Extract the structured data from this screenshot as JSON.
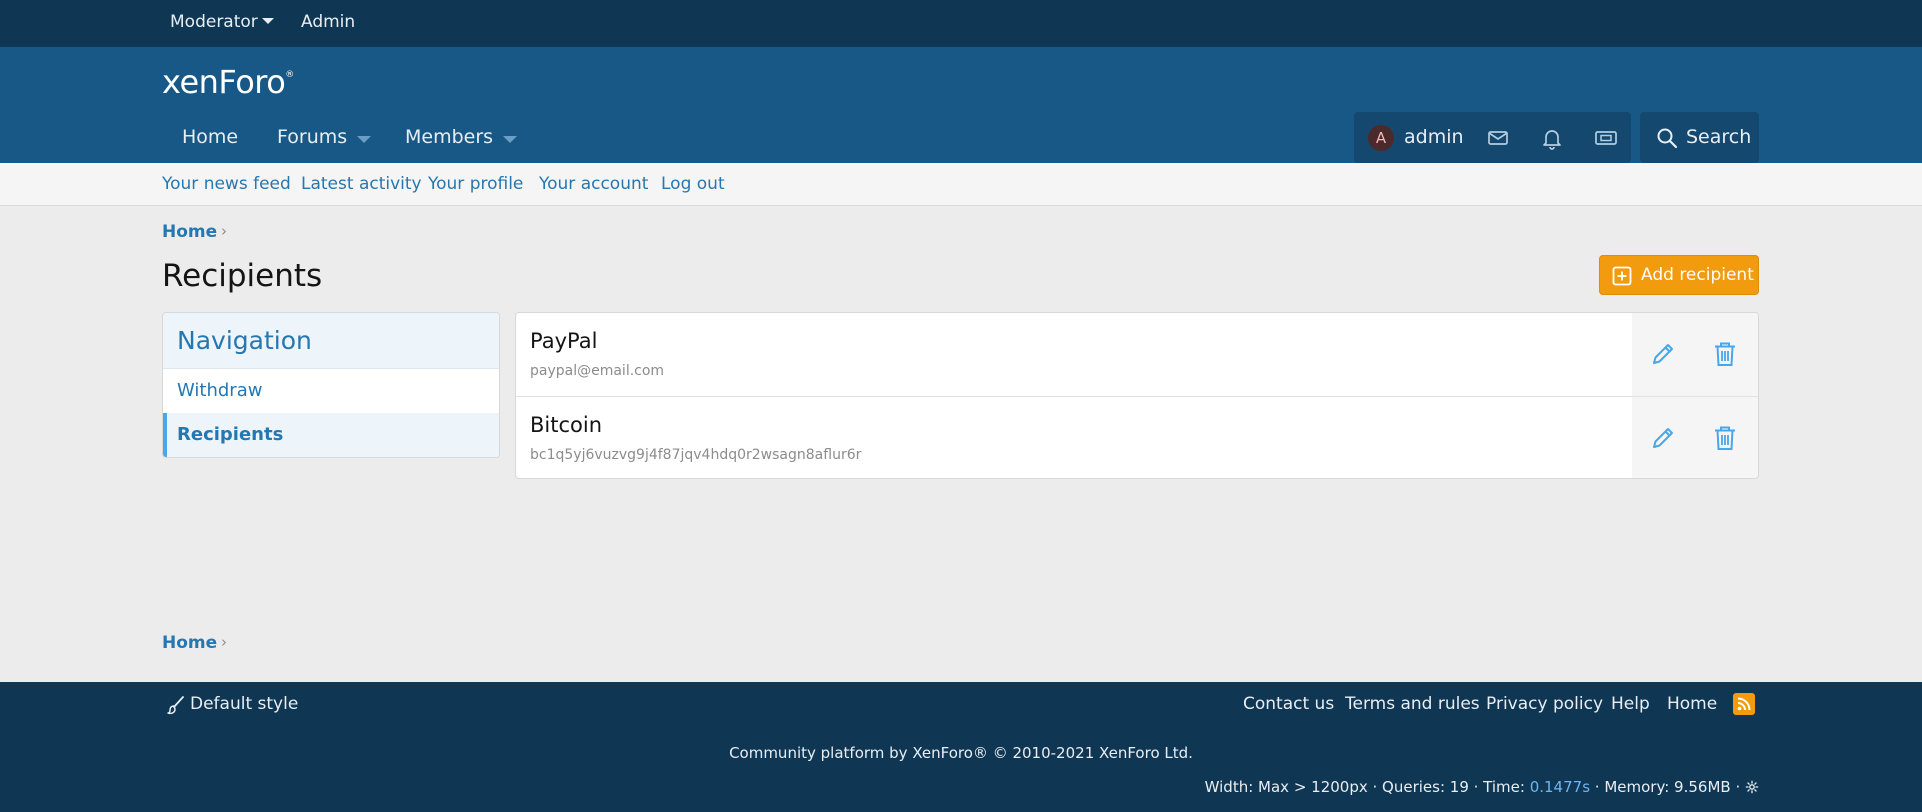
{
  "staffbar": {
    "moderator": "Moderator",
    "admin": "Admin"
  },
  "header": {
    "logo": "xenForo",
    "logo_mark": "®",
    "nav": {
      "home": "Home",
      "forums": "Forums",
      "members": "Members"
    },
    "user": {
      "avatar_letter": "A",
      "name": "admin"
    },
    "search_label": "Search"
  },
  "subnav": {
    "news_feed": "Your news feed",
    "latest_activity": "Latest activity",
    "your_profile": "Your profile",
    "your_account": "Your account",
    "log_out": "Log out"
  },
  "breadcrumb": {
    "home": "Home",
    "chevron": "›"
  },
  "page": {
    "title": "Recipients",
    "add_button": "Add recipient"
  },
  "sidenav": {
    "heading": "Navigation",
    "items": [
      {
        "label": "Withdraw"
      },
      {
        "label": "Recipients"
      }
    ]
  },
  "recipients": [
    {
      "name": "PayPal",
      "detail": "paypal@email.com"
    },
    {
      "name": "Bitcoin",
      "detail": "bc1q5yj6vuzvg9j4f87jqv4hdq0r2wsagn8aflur6r"
    }
  ],
  "footer": {
    "style": "Default style",
    "links": {
      "contact": "Contact us",
      "terms": "Terms and rules",
      "privacy": "Privacy policy",
      "help": "Help",
      "home": "Home"
    },
    "copyright": "Community platform by XenForo® © 2010-2021 XenForo Ltd.",
    "debug_prefix": "Width: Max > 1200px · Queries: 19 · Time: ",
    "debug_time": "0.1477s",
    "debug_suffix": " · Memory: 9.56MB · "
  },
  "colors": {
    "accent": "#2577b1",
    "header": "#185886",
    "staffbar": "#0f3652",
    "button": "#f29b0f"
  }
}
